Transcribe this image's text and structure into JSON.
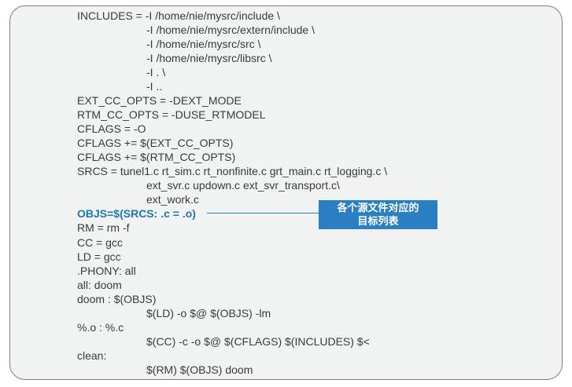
{
  "code_lines": [
    "INCLUDES = -I /home/nie/mysrc/include \\",
    "-I /home/nie/mysrc/extern/include \\",
    "-I /home/nie/mysrc/src \\",
    "-I /home/nie/mysrc/libsrc \\",
    "-I . \\",
    "-I ..",
    "EXT_CC_OPTS = -DEXT_MODE",
    "RTM_CC_OPTS = -DUSE_RTMODEL",
    "CFLAGS = -O",
    "CFLAGS += $(EXT_CC_OPTS)",
    "CFLAGS += $(RTM_CC_OPTS)",
    "SRCS = tunel1.c rt_sim.c rt_nonfinite.c grt_main.c rt_logging.c \\",
    "ext_svr.c updown.c ext_svr_transport.c\\",
    "ext_work.c",
    "OBJS=$(SRCS: .c = .o)",
    "RM = rm -f",
    "CC = gcc",
    "LD = gcc",
    ".PHONY: all",
    "all: doom",
    "doom : $(OBJS)",
    "$(LD) -o $@ $(OBJS) -lm",
    "%.o : %.c",
    "$(CC) -c -o $@ $(CFLAGS) $(INCLUDES) $<",
    "clean:",
    "$(RM) $(OBJS) doom"
  ],
  "callout": {
    "line1": "各个源文件对应的",
    "line2": "目标列表"
  },
  "colors": {
    "panel_background": "#f0f3f2",
    "panel_border": "#7f7f7f",
    "text": "#3a3a3a",
    "highlight_text": "#1f74b8",
    "callout_background": "#2a7ec1",
    "callout_text": "#ffffff"
  }
}
